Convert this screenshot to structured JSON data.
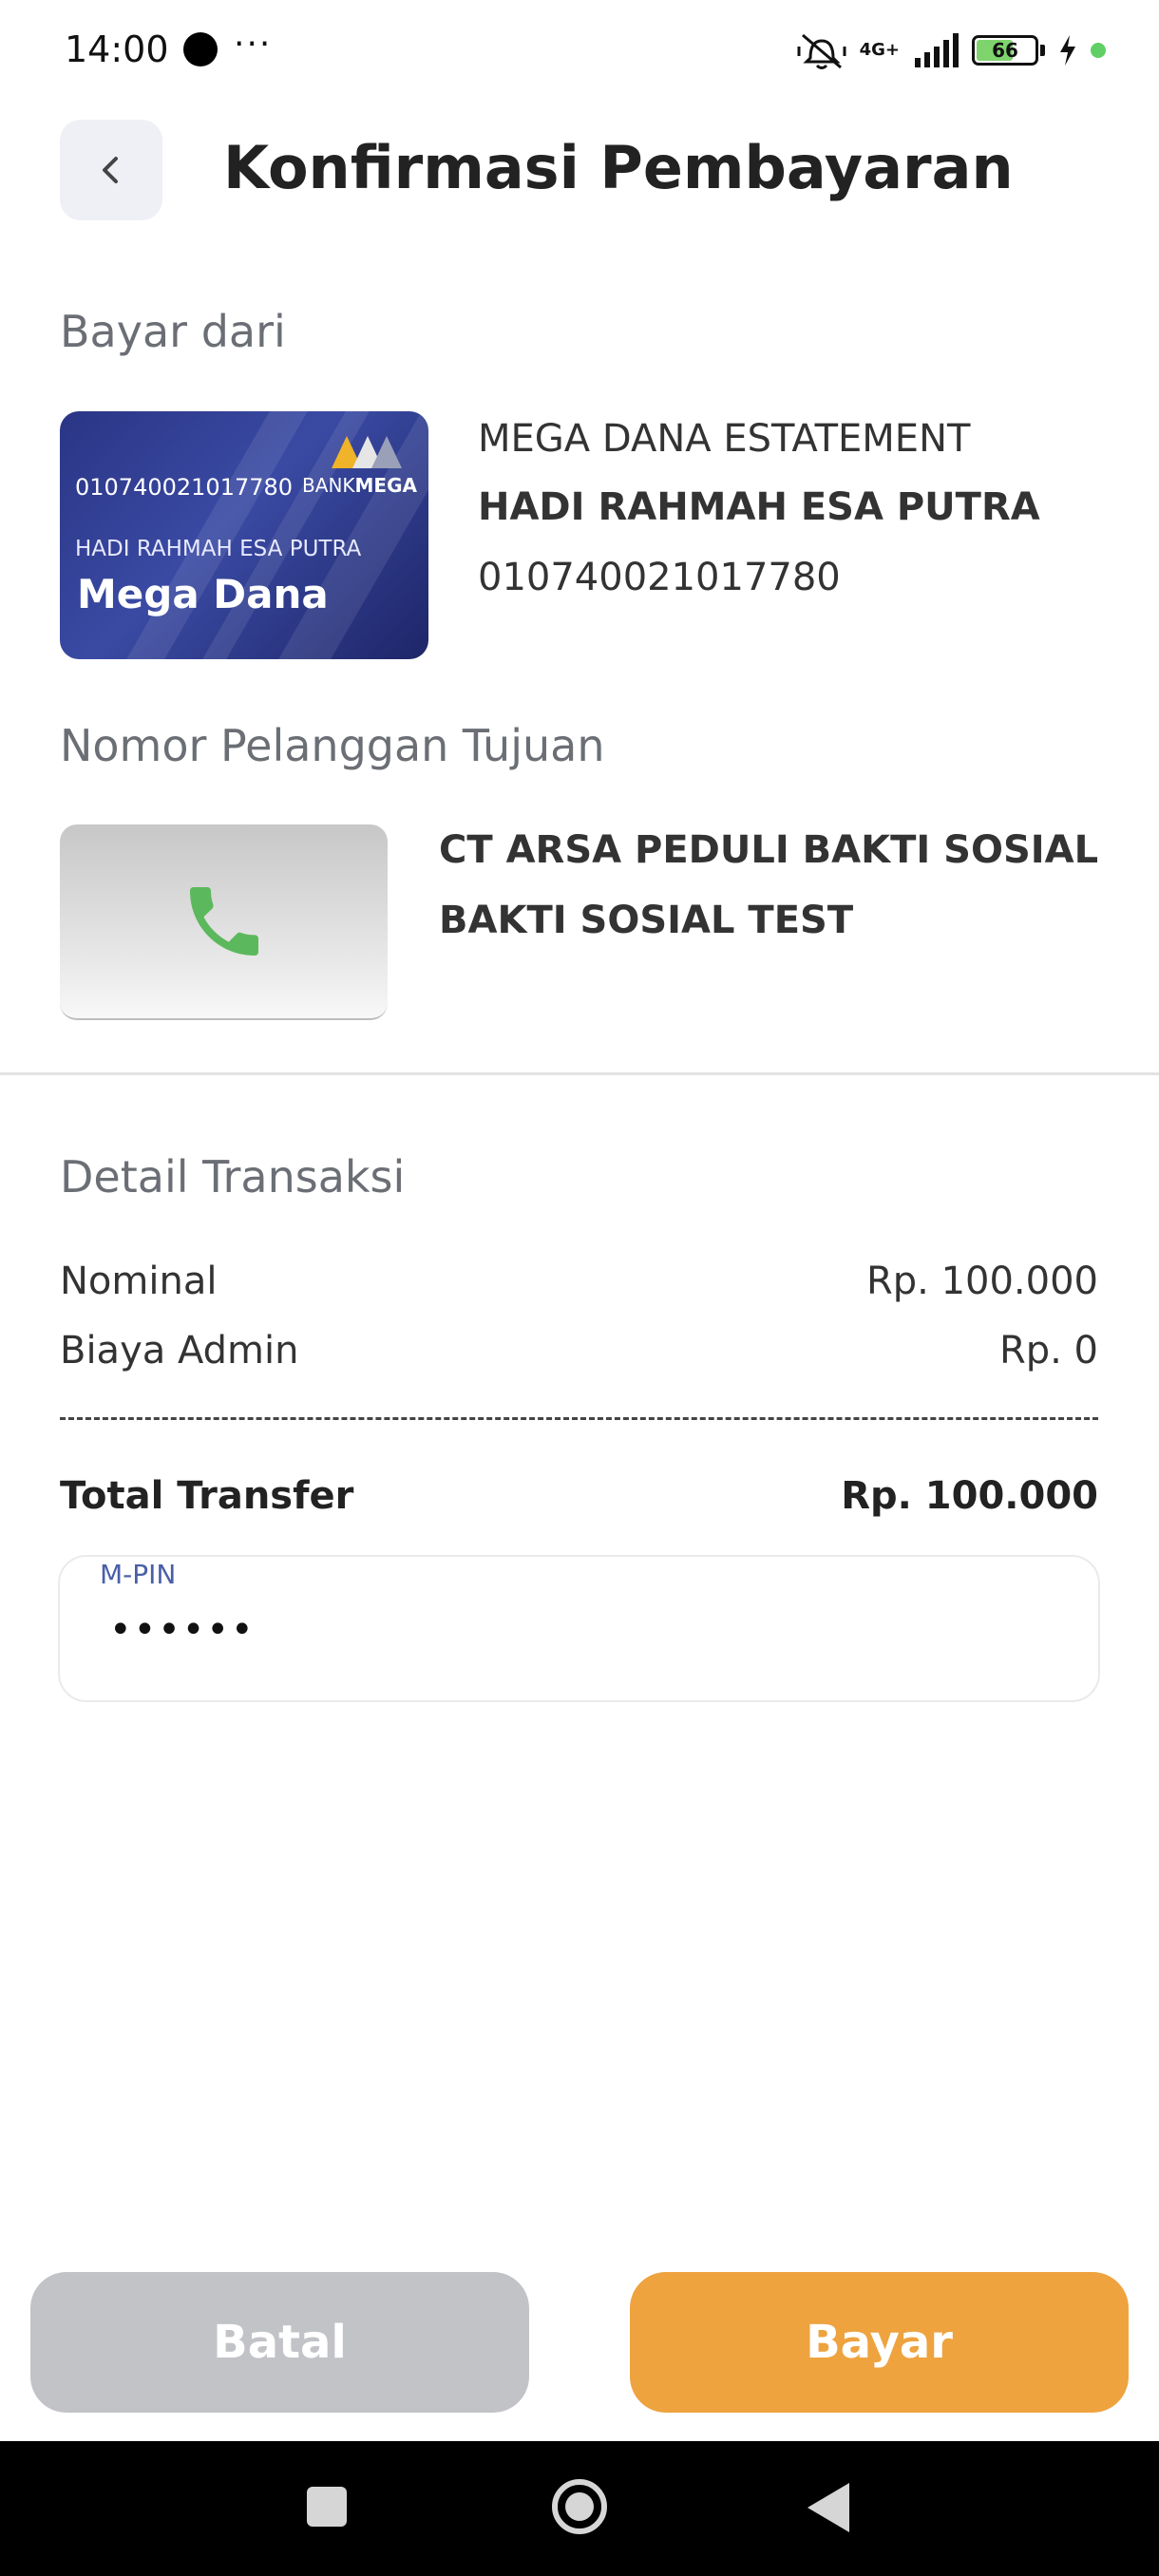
{
  "status_bar": {
    "time": "14:00",
    "more": "···",
    "network": "4G+",
    "battery": "66",
    "battery_level": 0.66
  },
  "header": {
    "title": "Konfirmasi Pembayaran"
  },
  "source": {
    "label": "Bayar dari",
    "card": {
      "number": "010740021017780",
      "holder": "HADI RAHMAH ESA PUTRA",
      "product": "Mega Dana",
      "bank_prefix": "BANK",
      "bank_name": "MEGA"
    },
    "account_type": "MEGA DANA ESTATEMENT",
    "account_name": "HADI RAHMAH ESA PUTRA",
    "account_number": "010740021017780"
  },
  "target": {
    "label": "Nomor Pelanggan Tujuan",
    "name": "CT ARSA PEDULI BAKTI SOSIAL",
    "detail": "BAKTI SOSIAL TEST"
  },
  "details": {
    "label": "Detail Transaksi",
    "rows": [
      {
        "label": "Nominal",
        "value": "Rp. 100.000"
      },
      {
        "label": "Biaya Admin",
        "value": "Rp. 0"
      }
    ],
    "total_label": "Total Transfer",
    "total_value": "Rp. 100.000"
  },
  "pin": {
    "label": "M-PIN",
    "value": "••••••"
  },
  "actions": {
    "cancel": "Batal",
    "pay": "Bayar"
  },
  "colors": {
    "primary": "#eea33f",
    "disabled": "#c2c3c7",
    "card": "#2a3585",
    "phone": "#5cb85c"
  }
}
